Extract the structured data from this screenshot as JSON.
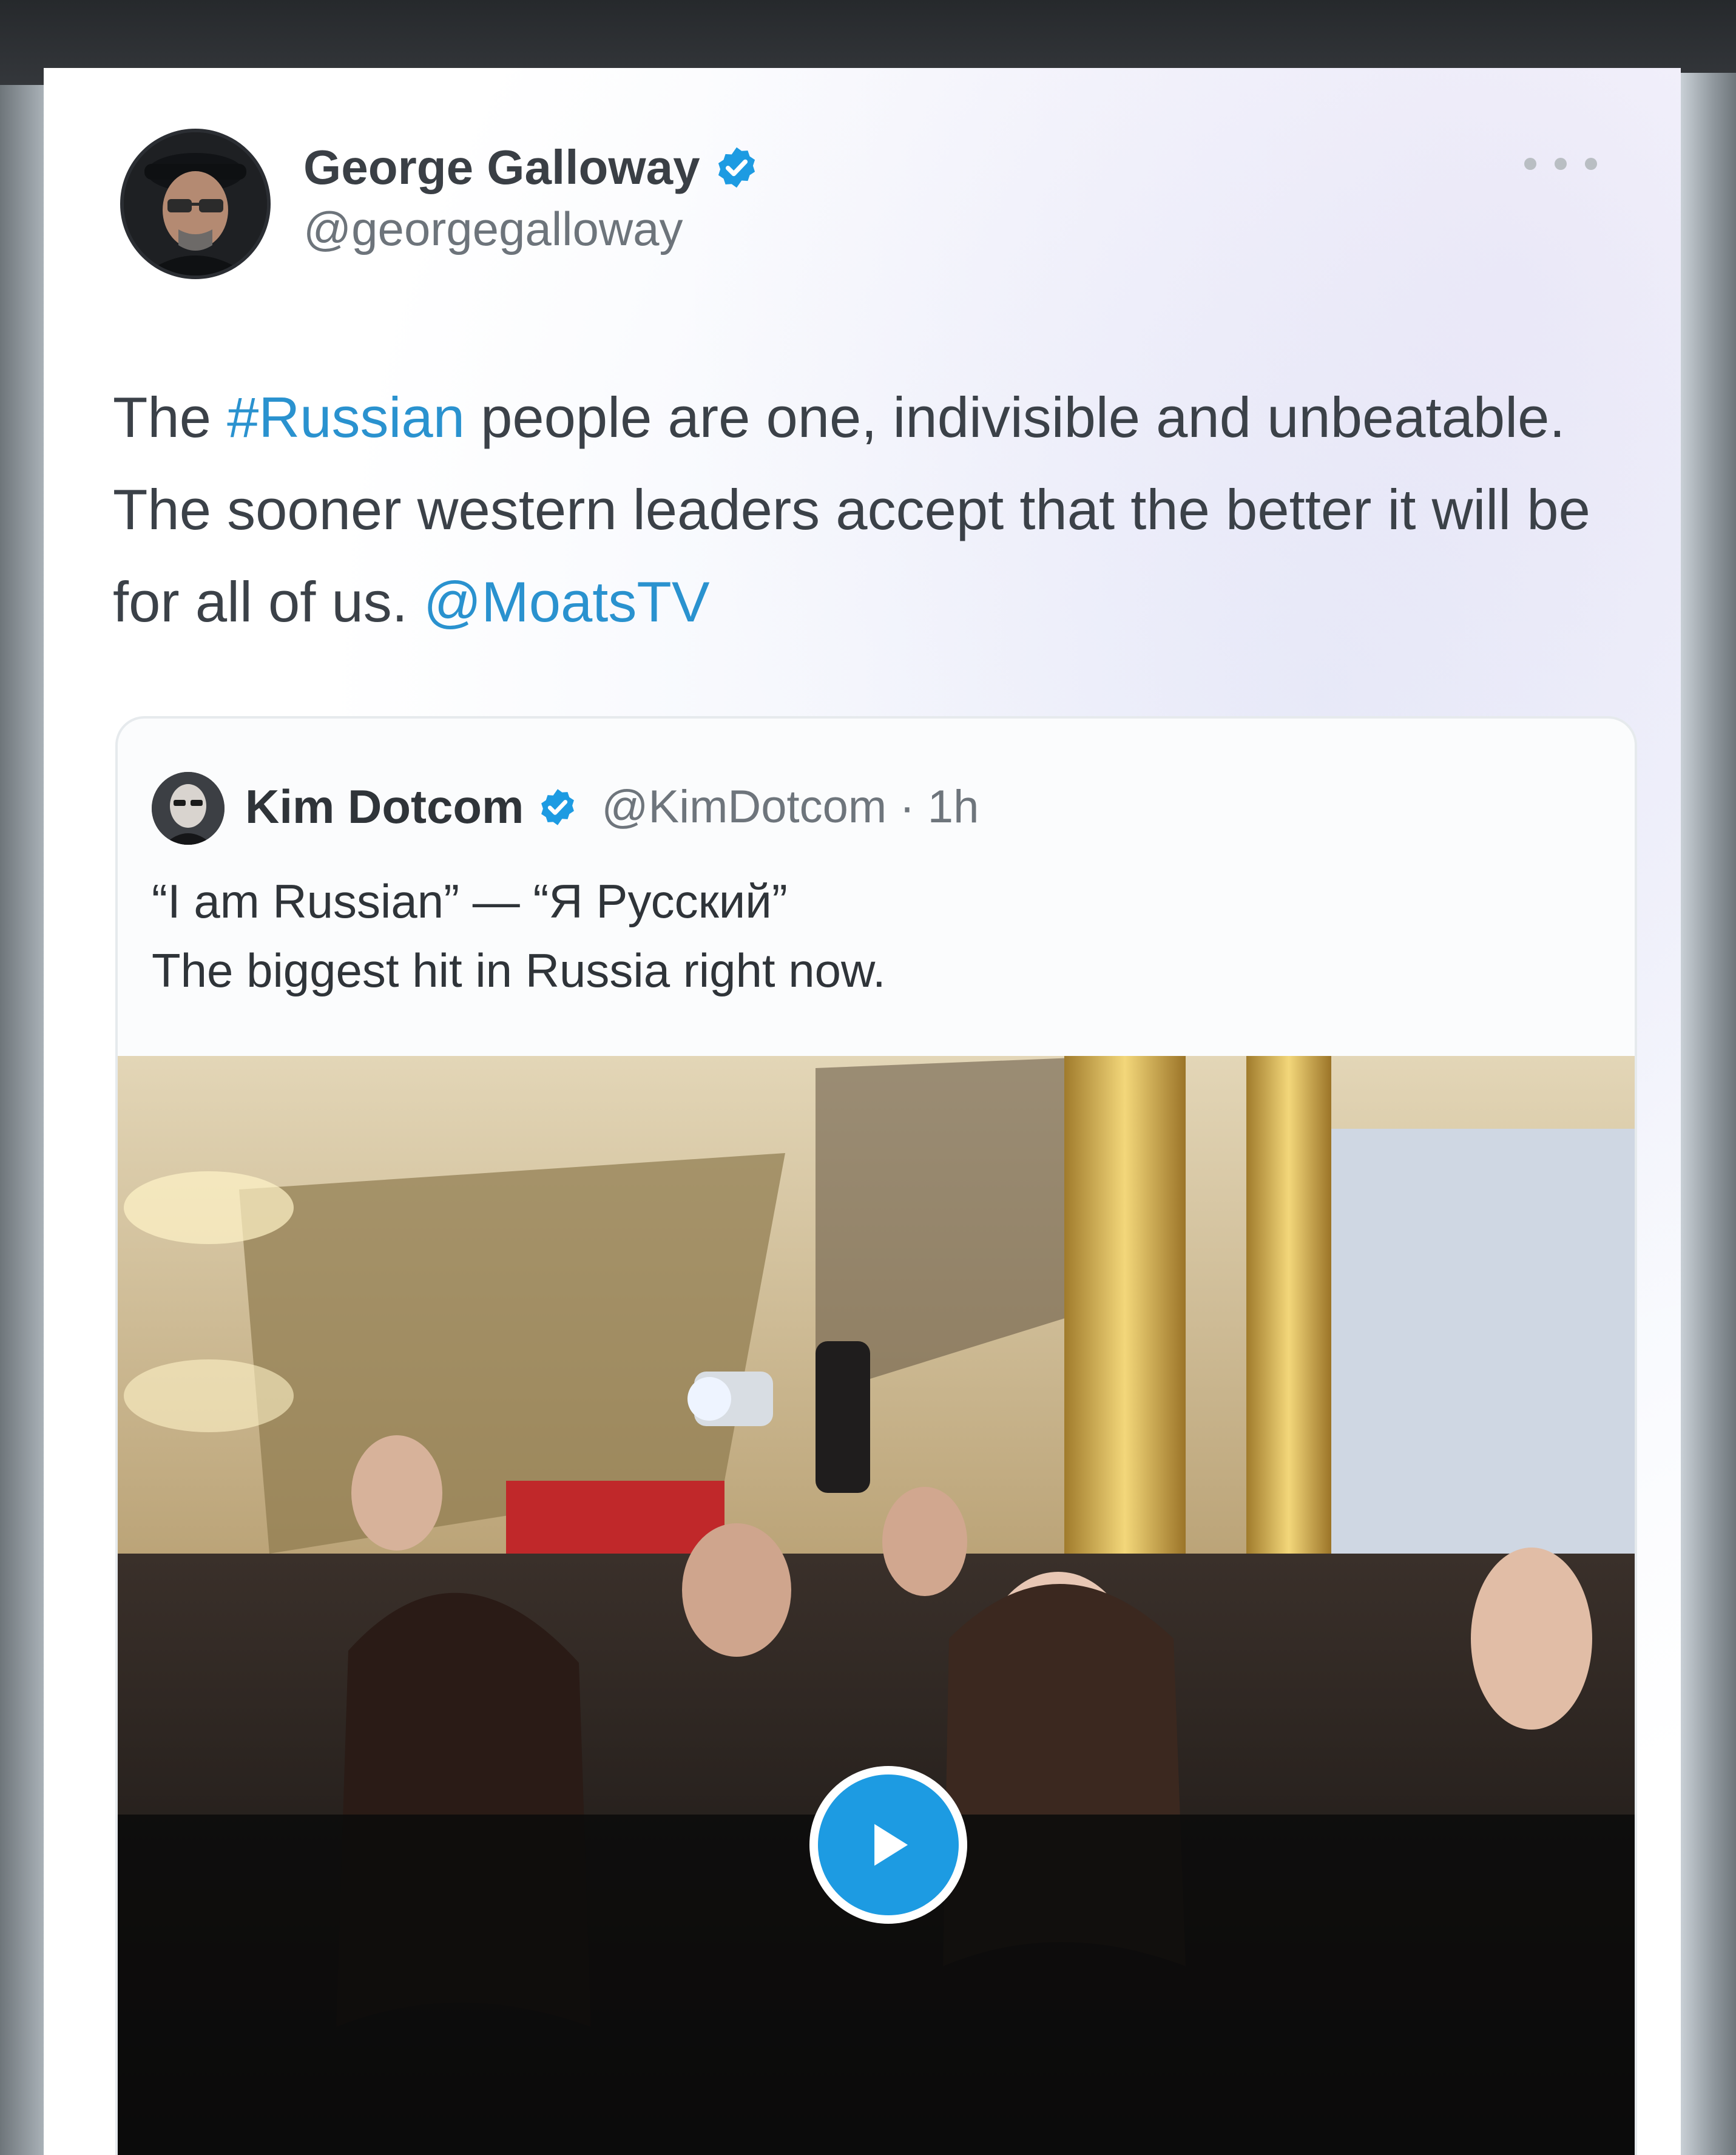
{
  "tweet": {
    "author": {
      "display_name": "George Galloway",
      "handle": "@georgegalloway",
      "verified": true
    },
    "text": {
      "part1": "The ",
      "hashtag": "#Russian",
      "part2": " people are one, indivisible and unbeatable. The sooner western leaders accept that the better it will be for all of us. ",
      "mention": "@MoatsTV"
    },
    "more_icon": "more-horizontal-icon"
  },
  "quoted_tweet": {
    "author": {
      "display_name": "Kim Dotcom",
      "handle": "@KimDotcom",
      "separator": " · ",
      "time": "1h",
      "verified": true
    },
    "text_line1": "“I am Russian” — “Я Русский”",
    "text_line2": "The biggest hit in Russia right now.",
    "media": {
      "type": "video",
      "play_icon": "play-icon"
    }
  },
  "colors": {
    "link": "#2a92cf",
    "verified": "#1d9be2",
    "play_button": "#1d9be2"
  }
}
